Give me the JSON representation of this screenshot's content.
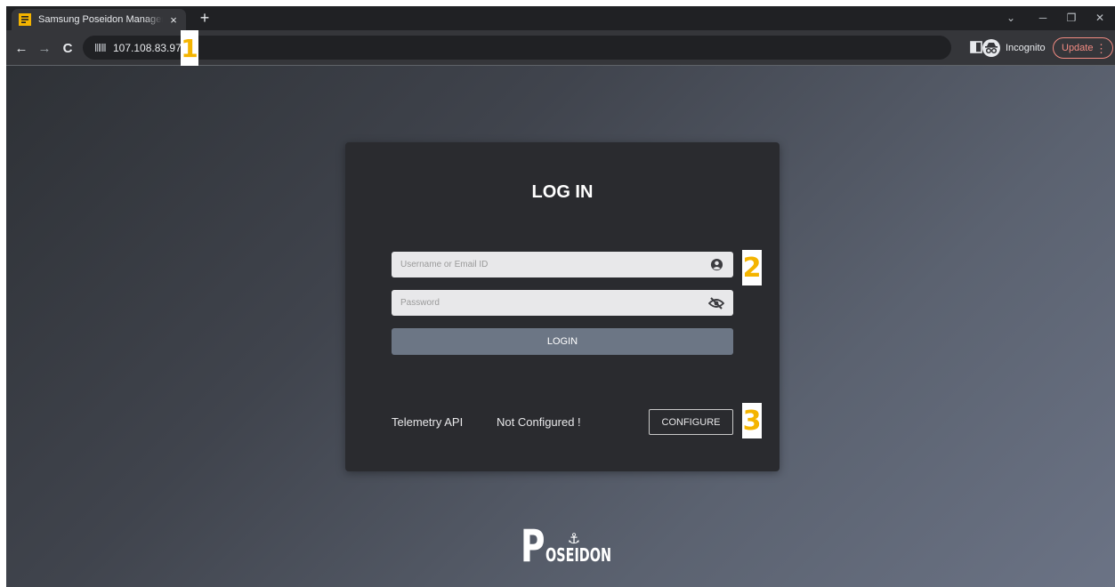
{
  "browser": {
    "tab_title": "Samsung Poseidon Management",
    "tab_close": "×",
    "new_tab": "+",
    "url": "107.108.83.97",
    "incognito_label": "Incognito",
    "update_label": "Update",
    "update_menu": "⋮",
    "nav": {
      "back": "←",
      "forward": "→",
      "reload": "C"
    },
    "window_controls": {
      "tab_search": "⌄",
      "minimize": "─",
      "restore": "❐",
      "close": "✕"
    }
  },
  "annotations": {
    "marker_1": "1",
    "marker_2": "2",
    "marker_3": "3"
  },
  "login": {
    "title": "LOG IN",
    "username_placeholder": "Username or Email ID",
    "password_placeholder": "Password",
    "login_button": "LOGIN",
    "telemetry_label": "Telemetry API",
    "telemetry_status": "Not Configured !",
    "configure_button": "CONFIGURE"
  },
  "logo": {
    "letter": "P",
    "anchor": "⚓",
    "text": "OSEIDON"
  },
  "colors": {
    "accent_update": "#f28b82",
    "marker": "#f4b400",
    "login_button": "#6c7685",
    "card": "#2a2b2f"
  }
}
